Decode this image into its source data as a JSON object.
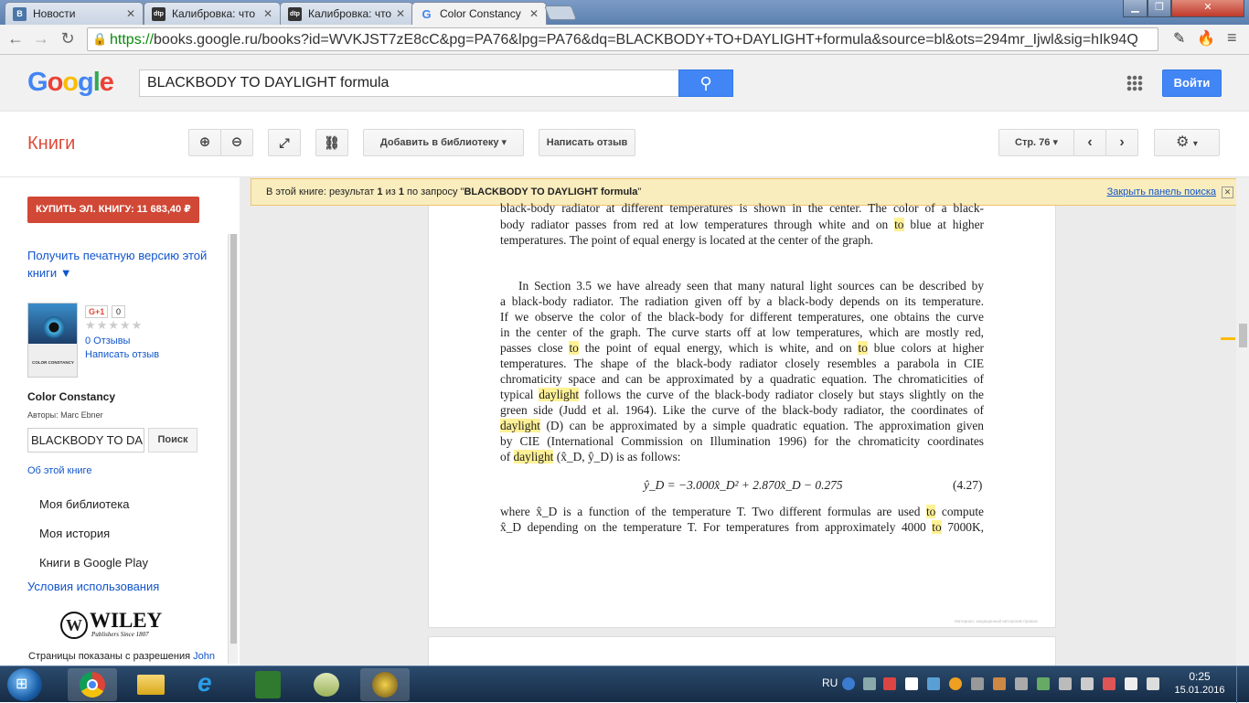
{
  "browser": {
    "tabs": [
      {
        "favicon": "В",
        "title": "Новости",
        "color": "#4a76a8"
      },
      {
        "favicon": "dtp",
        "title": "Калибровка: что",
        "color": "#333333"
      },
      {
        "favicon": "dtp",
        "title": "Калибровка: что",
        "color": "#333333"
      },
      {
        "favicon": "G",
        "title": "Color Constancy",
        "color": "#4285f4"
      }
    ],
    "url_scheme": "https://",
    "url_rest": "books.google.ru/books?id=WVKJST7zE8cC&pg=PA76&lpg=PA76&dq=BLACKBODY+TO+DAYLIGHT+formula&source=bl&ots=294mr_Ijwl&sig=hIk94Q"
  },
  "google": {
    "logo": "Google",
    "search_value": "BLACKBODY TO DAYLIGHT formula",
    "signin": "Войти"
  },
  "books": {
    "title": "Книги",
    "add_library": "Добавить в библиотеку",
    "write_review": "Написать отзыв",
    "page_label": "Стр. 76"
  },
  "notice": {
    "prefix": "В этой книге: результат ",
    "n": "1",
    "mid": " из ",
    "total": "1",
    "query_prefix": " по запросу \"",
    "query": "BLACKBODY TO DAYLIGHT formula",
    "query_suffix": "\"",
    "close_link": "Закрыть панель поиска"
  },
  "sidebar": {
    "buy": "КУПИТЬ ЭЛ. КНИГУ: 11 683,40 ₽",
    "print_link": "Получить печатную версию этой книги ▼",
    "gplus": "G+1",
    "gplus_count": "0",
    "reviews": "0 Отзывы",
    "write_review": "Написать отзыв",
    "book_title": "Color Constancy",
    "authors": "Авторы: Marc Ebner",
    "search_value": "BLACKBODY TO DA",
    "search_btn": "Поиск",
    "about": "Об этой книге",
    "menu": [
      "Моя библиотека",
      "Моя история",
      "Книги в Google Play"
    ],
    "terms": "Условия использования",
    "publisher_logo": "WILEY",
    "publisher_sub": "Publishers Since 1807",
    "permission": "Страницы показаны с разрешения",
    "permission_link": "John",
    "cover_text": "COLOR CONSTANCY"
  },
  "book_page": {
    "lines": [
      "black-body radiator at different temperatures is shown in the center. The color of a black-",
      [
        "body radiator passes from red at low temperatures through white and on ",
        "to",
        " blue at higher"
      ],
      "temperatures. The point of equal energy is located at the center of the graph.",
      "In Section 3.5 we have already seen that many natural light sources can be described by",
      "a black-body radiator. The radiation given off by a black-body depends on its temperature.",
      "If we observe the color of the black-body for different temperatures, one obtains the curve",
      "in the center of the graph. The curve starts off at low temperatures, which are mostly red,",
      [
        "passes close ",
        "to",
        " the point of equal energy, which is white, and on ",
        "to",
        " blue colors at higher"
      ],
      "temperatures. The shape of the black-body radiator closely resembles a parabola in CIE",
      "chromaticity space and can be approximated by a quadratic equation. The chromaticities of",
      [
        "typical ",
        "daylight",
        " follows the curve of the black-body radiator closely but stays slightly on the"
      ],
      "green side (Judd et al. 1964). Like the curve of the black-body radiator, the coordinates of",
      [
        "",
        "daylight",
        " (D) can be approximated by a simple quadratic equation. The approximation given"
      ],
      "by CIE  (International Commission on Illumination 1996) for the chromaticity coordinates",
      [
        "of ",
        "daylight",
        " (x̂_D, ŷ_D) is as follows:"
      ],
      [
        "where x̂_D is a function of the temperature T. Two different formulas are used ",
        "to",
        " compute"
      ],
      [
        "x̂_D depending on the temperature T. For temperatures from approximately 4000 ",
        "to",
        " 7000K,"
      ]
    ],
    "equation": "ŷ_D = −3.000x̂_D² + 2.870x̂_D − 0.275",
    "equation_number": "(4.27)",
    "watermark": "Материал, защищенный авторским правом"
  },
  "taskbar": {
    "lang": "RU",
    "time": "0:25",
    "date": "15.01.2016"
  },
  "colors": {
    "accent": "#4285f4",
    "books_red": "#dd4b39",
    "buy_red": "#d14836",
    "highlight": "#fff196"
  }
}
